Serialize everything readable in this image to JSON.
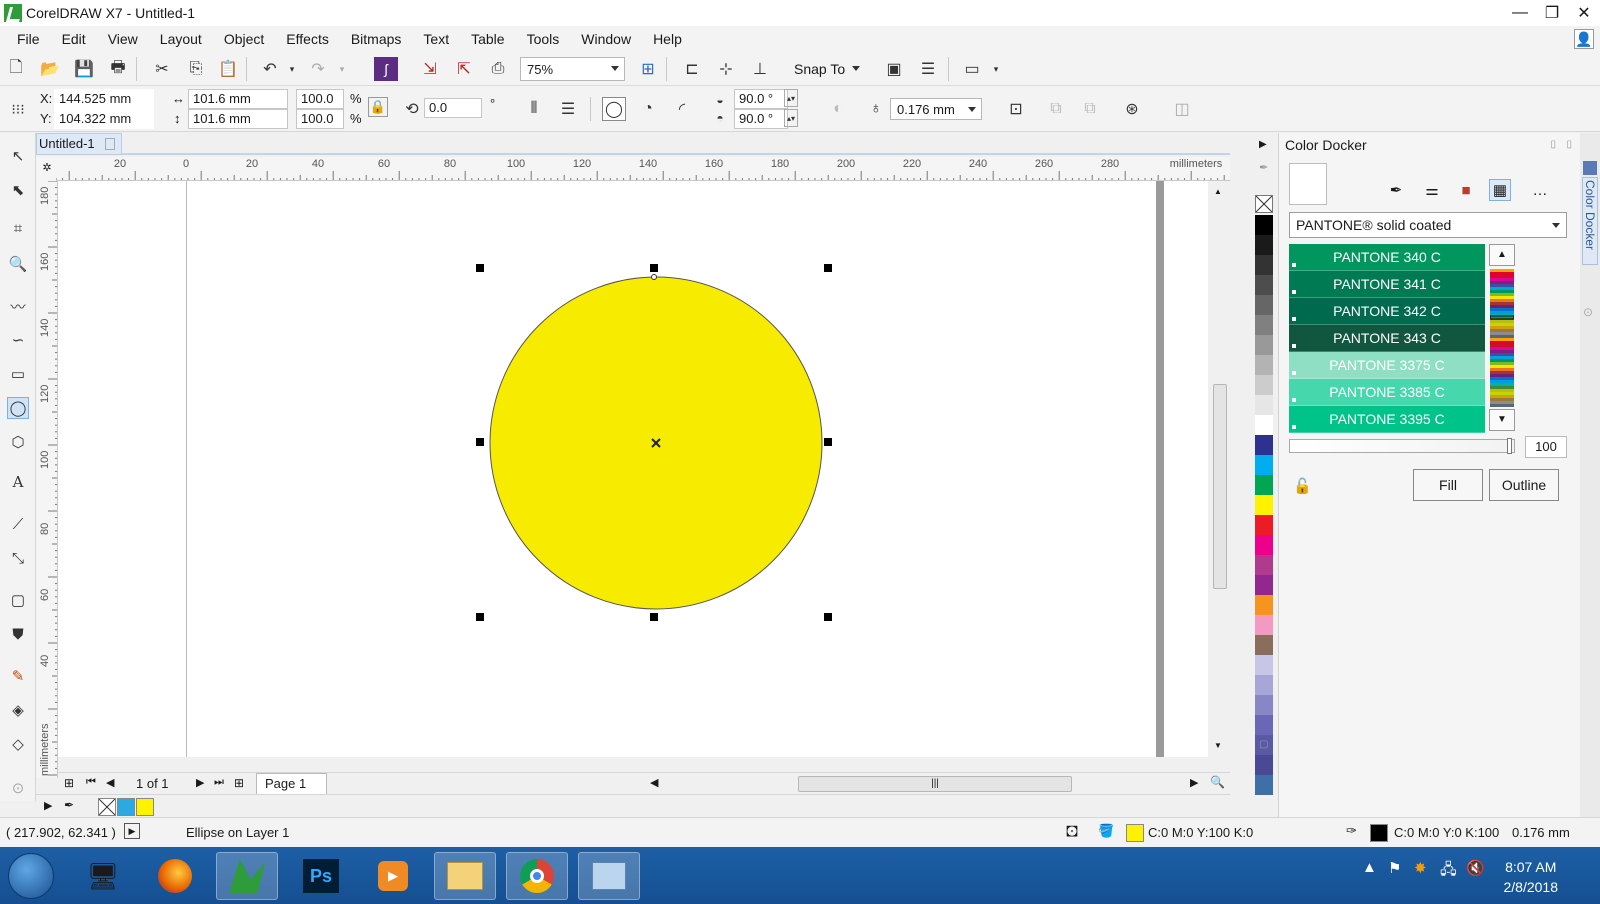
{
  "window": {
    "title": "CorelDRAW X7 - Untitled-1",
    "minimize": "—",
    "restore": "❐",
    "close": "✕"
  },
  "menu": [
    "File",
    "Edit",
    "View",
    "Layout",
    "Object",
    "Effects",
    "Bitmaps",
    "Text",
    "Table",
    "Tools",
    "Window",
    "Help"
  ],
  "standard_toolbar": {
    "zoom": "75%",
    "snap_to": "Snap To"
  },
  "property_bar": {
    "x_label": "X:",
    "x_value": "144.525 mm",
    "y_label": "Y:",
    "y_value": "104.322 mm",
    "width_value": "101.6 mm",
    "height_value": "101.6 mm",
    "scale_x": "100.0",
    "scale_y": "100.0",
    "percent": "%",
    "rotation": "0.0",
    "degree": "°",
    "start_angle": "90.0 °",
    "end_angle": "90.0 °",
    "outline_width": "0.176 mm"
  },
  "document": {
    "tab_label": "Untitled-1",
    "ruler_units": "millimeters",
    "h_ruler_labels": [
      "20",
      "0",
      "20",
      "40",
      "60",
      "80",
      "100",
      "120",
      "140",
      "160",
      "180",
      "200",
      "220",
      "240",
      "260",
      "280"
    ],
    "v_ruler_labels": [
      "180",
      "160",
      "140",
      "120",
      "100",
      "80",
      "60",
      "40",
      "millimeters"
    ],
    "ellipse_fill": "#f7ec00",
    "page_count": "1 of 1",
    "page_tab": "Page 1"
  },
  "color_palette": [
    "#000000",
    "#1a1a1a",
    "#333333",
    "#4d4d4d",
    "#666666",
    "#808080",
    "#999999",
    "#b3b3b3",
    "#cccccc",
    "#e6e6e6",
    "#ffffff",
    "#2e3192",
    "#00aeef",
    "#00a651",
    "#fff200",
    "#ed1c24",
    "#ec008c",
    "#b03a8c",
    "#92278f",
    "#f7941d",
    "#f49ac2",
    "#8b6d5c",
    "#c7c6e8",
    "#a8a6d6",
    "#8886c6",
    "#6a68b6",
    "#5a59a6",
    "#4a4996",
    "#3e6fa8"
  ],
  "doc_palette": [
    "#29abe2",
    "#fff200"
  ],
  "docker": {
    "title": "Color Docker",
    "palette_name": "PANTONE® solid coated",
    "swatches": [
      {
        "name": "PANTONE 340 C",
        "color": "#00965e"
      },
      {
        "name": "PANTONE 341 C",
        "color": "#007a53"
      },
      {
        "name": "PANTONE 342 C",
        "color": "#006a4e"
      },
      {
        "name": "PANTONE 343 C",
        "color": "#115740"
      },
      {
        "name": "PANTONE 3375 C",
        "color": "#8edfc4"
      },
      {
        "name": "PANTONE 3385 C",
        "color": "#47d7ac"
      },
      {
        "name": "PANTONE 3395 C",
        "color": "#00c389"
      }
    ],
    "tint_value": "100",
    "fill_label": "Fill",
    "outline_label": "Outline",
    "side_tab": "Color Docker"
  },
  "status": {
    "cursor_coords": "( 217.902, 62.341 )",
    "object_info": "Ellipse on Layer 1",
    "fill_color_text": "C:0 M:0 Y:100 K:0",
    "fill_swatch": "#fff200",
    "outline_color_text": "C:0 M:0 Y:0 K:100",
    "outline_width": "0.176 mm",
    "outline_swatch": "#000000"
  },
  "taskbar": {
    "time": "8:07 AM",
    "date": "2/8/2018"
  }
}
